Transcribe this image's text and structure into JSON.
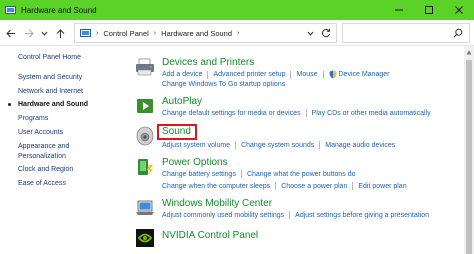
{
  "window": {
    "title": "Hardware and Sound",
    "minimize_icon": "minimize-icon",
    "maximize_icon": "maximize-icon",
    "close_icon": "close-icon"
  },
  "address": {
    "crumbs": [
      "Control Panel",
      "Hardware and Sound"
    ],
    "separator": "›",
    "back_icon": "back-arrow-icon",
    "forward_icon": "forward-arrow-icon",
    "recent_icon": "chevron-down-icon",
    "up_icon": "up-arrow-icon",
    "refresh_icon": "refresh-icon",
    "search_icon": "search-icon"
  },
  "sidebar": {
    "items": [
      {
        "label": "Control Panel Home",
        "active": false
      },
      {
        "label": "System and Security",
        "active": false
      },
      {
        "label": "Network and Internet",
        "active": false
      },
      {
        "label": "Hardware and Sound",
        "active": true
      },
      {
        "label": "Programs",
        "active": false
      },
      {
        "label": "User Accounts",
        "active": false
      },
      {
        "label": "Appearance and",
        "active": false
      },
      {
        "label": "Personalization",
        "active": false
      },
      {
        "label": "Clock and Region",
        "active": false
      },
      {
        "label": "Ease of Access",
        "active": false
      }
    ]
  },
  "categories": [
    {
      "title": "Devices and Printers",
      "icon": "printer-icon",
      "rows": [
        [
          "Add a device",
          "Advanced printer setup",
          "Mouse",
          "Device Manager"
        ],
        [
          "Change Windows To Go startup options"
        ]
      ]
    },
    {
      "title": "AutoPlay",
      "icon": "autoplay-icon",
      "rows": [
        [
          "Change default settings for media or devices",
          "Play CDs or other media automatically"
        ]
      ]
    },
    {
      "title": "Sound",
      "icon": "speaker-icon",
      "highlighted": true,
      "rows": [
        [
          "Adjust system volume",
          "Change system sounds",
          "Manage audio devices"
        ]
      ]
    },
    {
      "title": "Power Options",
      "icon": "power-options-icon",
      "rows": [
        [
          "Change battery settings",
          "Change what the power buttons do"
        ],
        [
          "Change when the computer sleeps",
          "Choose a power plan",
          "Edit power plan"
        ]
      ]
    },
    {
      "title": "Windows Mobility Center",
      "icon": "mobility-center-icon",
      "rows": [
        [
          "Adjust commonly used mobility settings",
          "Adjust settings before giving a presentation"
        ]
      ]
    },
    {
      "title": "NVIDIA Control Panel",
      "icon": "nvidia-icon",
      "rows": []
    }
  ],
  "colors": {
    "titlebar": "#5bd228",
    "category_title": "#14892c",
    "link": "#1e64b4",
    "nav_link": "#1e3c78",
    "highlight_box": "#e0141e"
  }
}
